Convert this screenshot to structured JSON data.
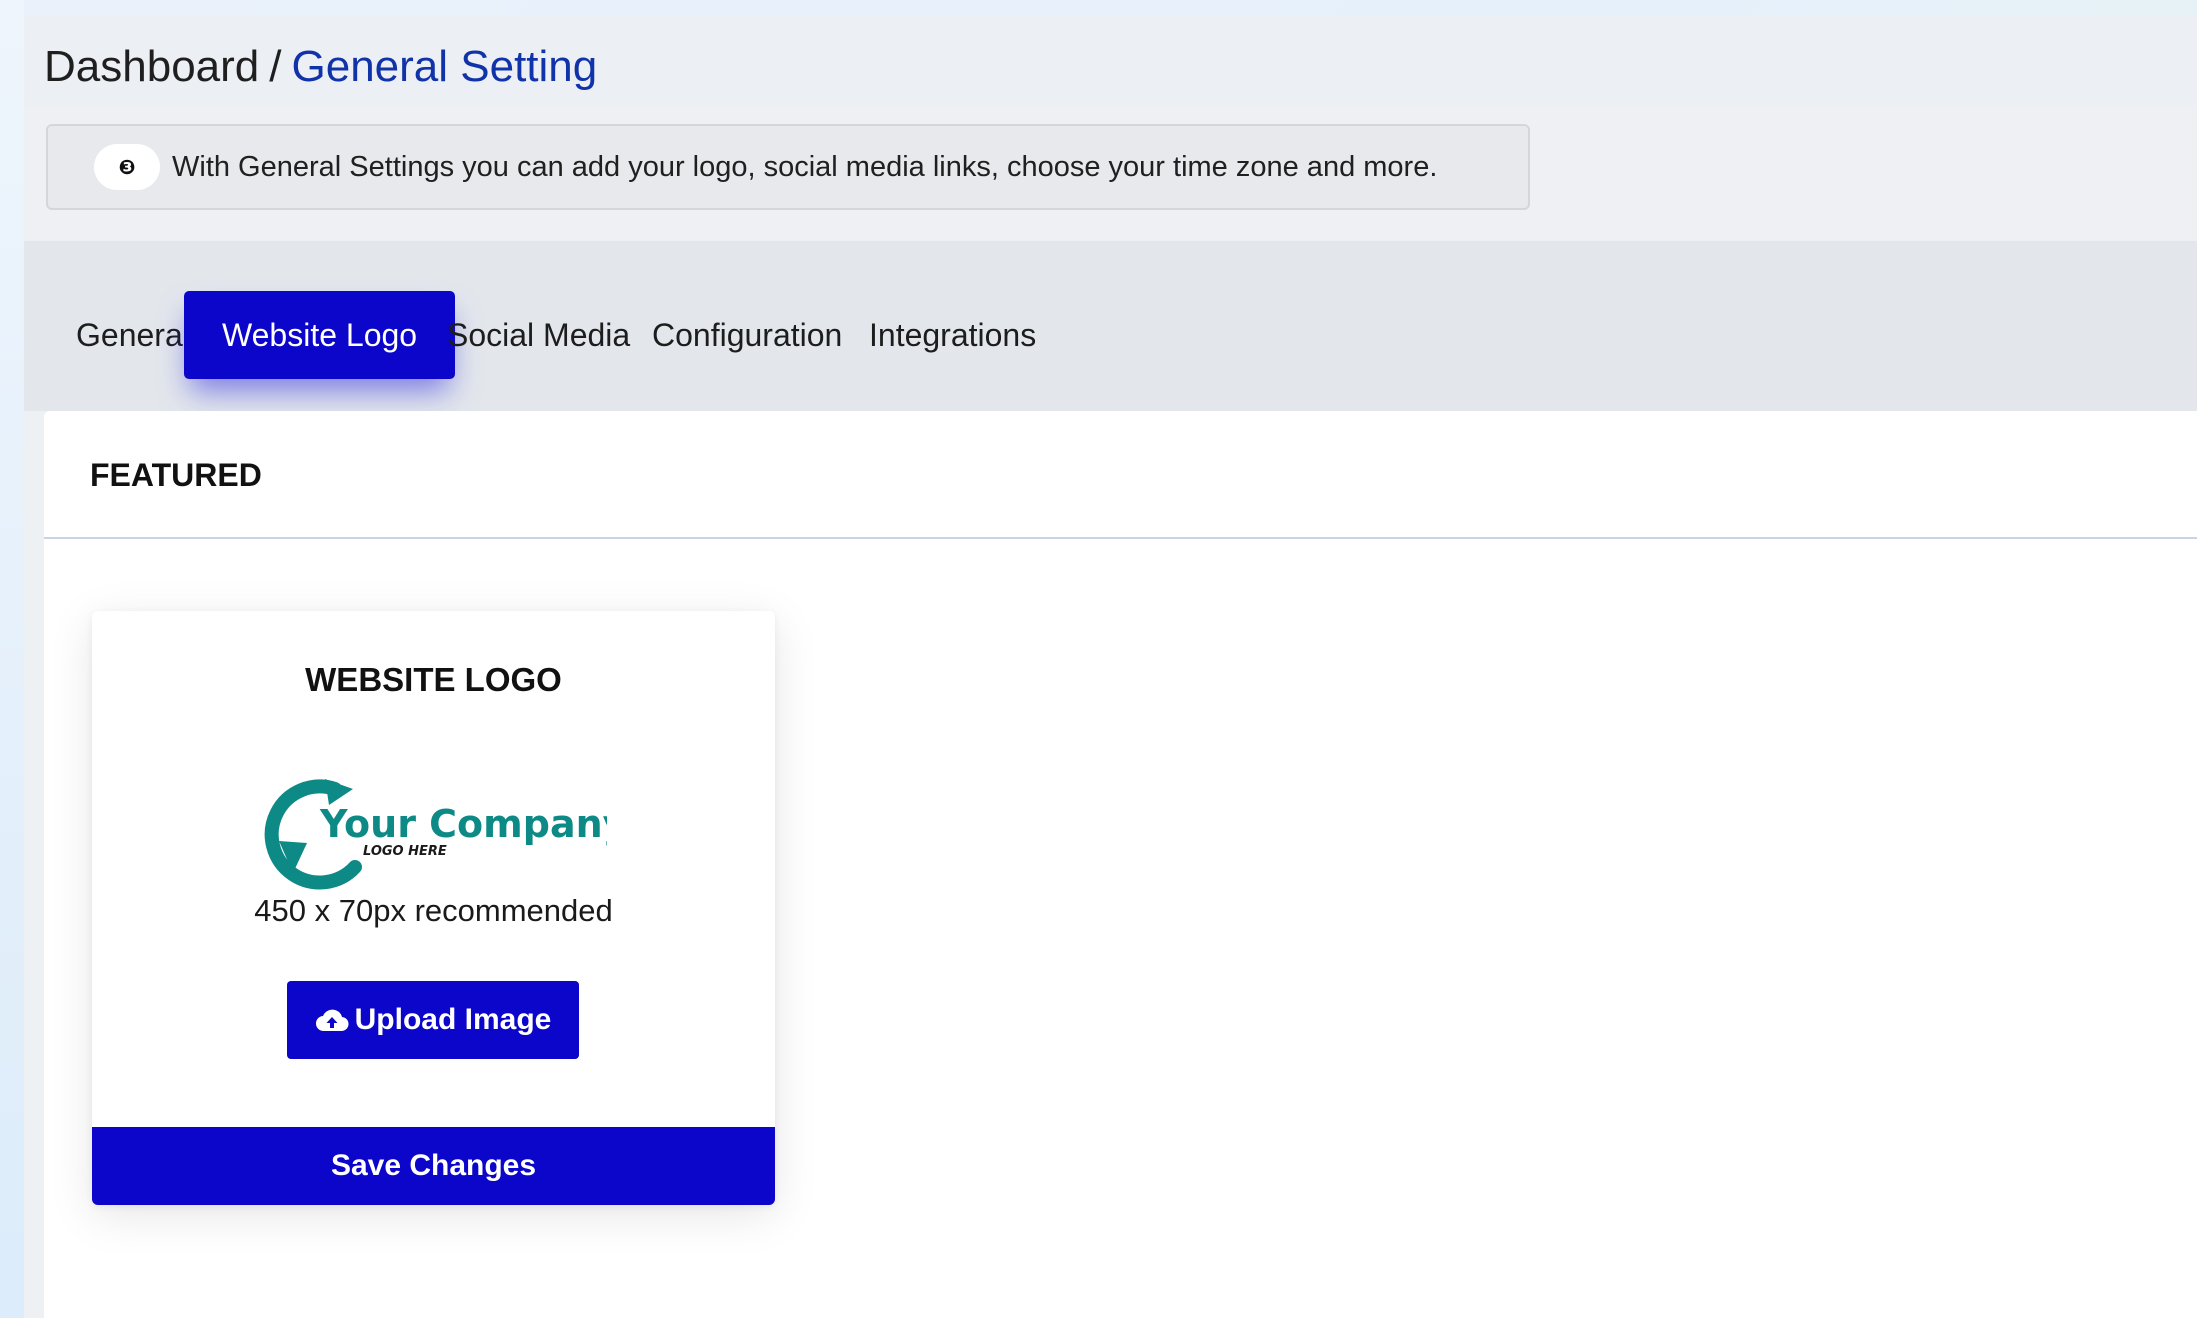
{
  "breadcrumb": {
    "root": "Dashboard",
    "separator": "/",
    "current": "General Setting"
  },
  "info": {
    "icon": "info-icon",
    "text": "With General Settings you can add your logo, social media links, choose your time zone and more."
  },
  "tabs": [
    {
      "label": "General",
      "active": false
    },
    {
      "label": "Website Logo",
      "active": true
    },
    {
      "label": "Social Media",
      "active": false
    },
    {
      "label": "Configuration",
      "active": false
    },
    {
      "label": "Integrations",
      "active": false
    }
  ],
  "featured": {
    "title": "FEATURED"
  },
  "logo_card": {
    "title": "WEBSITE LOGO",
    "logo_text": "Your Company",
    "logo_subtext": "LOGO HERE",
    "recommendation": "450 x 70px recommended",
    "upload_label": "Upload Image",
    "upload_icon": "cloud-upload-icon",
    "save_label": "Save Changes"
  },
  "colors": {
    "primary": "#0b06c9",
    "breadcrumb_active": "#1133aa",
    "logo_teal": "#0e8a86"
  }
}
